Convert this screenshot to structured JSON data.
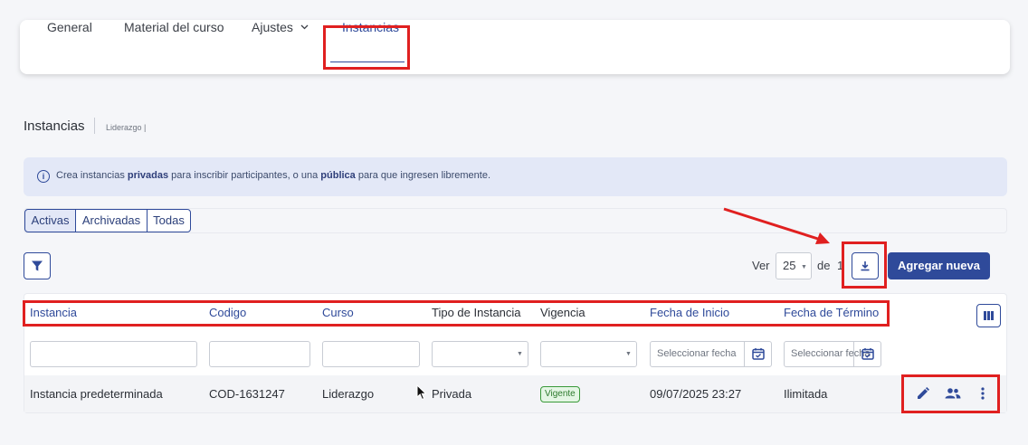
{
  "tabs": [
    {
      "label": "General"
    },
    {
      "label": "Material del curso"
    },
    {
      "label": "Ajustes",
      "has_dropdown": true
    },
    {
      "label": "Instancias",
      "active": true
    }
  ],
  "page": {
    "title": "Instancias",
    "subtitle": "Liderazgo |"
  },
  "info_banner": {
    "text_1": "Crea instancias ",
    "bold_1": "privadas",
    "text_2": " para inscribir participantes, o una ",
    "bold_2": "pública",
    "text_3": " para que ingresen libremente.",
    "icon": "info-icon"
  },
  "status_filter": {
    "options": [
      "Activas",
      "Archivadas",
      "Todas"
    ],
    "selected": "Activas"
  },
  "toolbar": {
    "ver_label": "Ver",
    "page_size": "25",
    "de_label": "de",
    "total_pages": "1",
    "add_label": "Agregar nueva"
  },
  "table": {
    "columns": [
      "Instancia",
      "Codigo",
      "Curso",
      "Tipo de Instancia",
      "Vigencia",
      "Fecha de Inicio",
      "Fecha de Término"
    ],
    "date_placeholder": "Seleccionar fecha",
    "rows": [
      {
        "instancia": "Instancia predeterminada",
        "codigo": "COD-1631247",
        "curso": "Liderazgo",
        "tipo": "Privada",
        "vigencia": "Vigente",
        "fecha_inicio": "09/07/2025 23:27",
        "fecha_termino": "Ilimitada"
      }
    ]
  },
  "colors": {
    "accent": "#2f4a9a",
    "highlight": "#e02020",
    "badge_green": "#3a9a3a",
    "info_bg": "#e3e8f7"
  }
}
